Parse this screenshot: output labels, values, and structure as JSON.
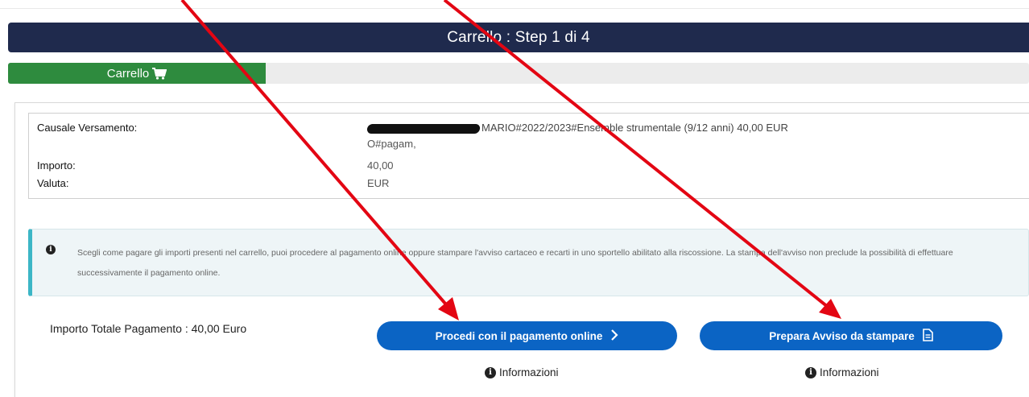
{
  "header": {
    "title": "Carrello : Step 1 di 4"
  },
  "stepper": {
    "active_label": "Carrello"
  },
  "details": {
    "causale_label": "Causale Versamento:",
    "causale_value": "MARIO#2022/2023#Ensemble strumentale (9/12 anni) 40,00 EUR",
    "causale_value_line2": "O#pagam,",
    "importo_label": "Importo:",
    "importo_value": "40,00",
    "valuta_label": "Valuta:",
    "valuta_value": "EUR"
  },
  "alert": {
    "text": "Scegli come pagare gli importi presenti nel carrello, puoi procedere al pagamento online oppure stampare l'avviso cartaceo e recarti in uno sportello abilitato alla riscossione. La stampa dell'avviso non preclude la possibilità di effettuare successivamente il pagamento online."
  },
  "footer": {
    "total": "Importo Totale Pagamento : 40,00 Euro",
    "online_button": "Procedi con il pagamento online",
    "avviso_button": "Prepara Avviso da stampare",
    "info_1": "Informazioni",
    "info_2": "Informazioni"
  },
  "colors": {
    "header_bg": "#1f2a4d",
    "step_active": "#2e8b3e",
    "button_blue": "#0b64c4",
    "alert_accent": "#3cb6c6",
    "annotation_arrow": "#e30613"
  },
  "icons": [
    "cart-icon",
    "info-icon",
    "chevron-right-icon",
    "document-icon"
  ]
}
